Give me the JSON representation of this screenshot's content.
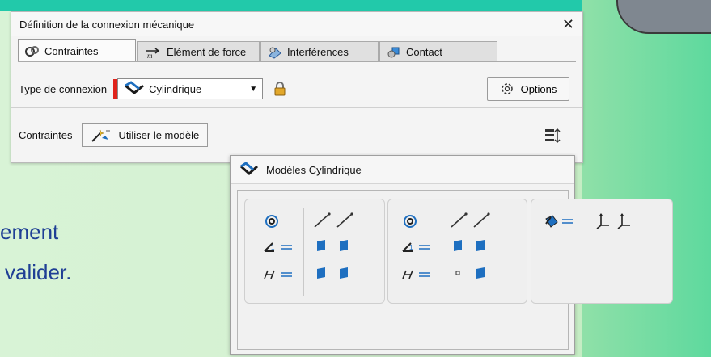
{
  "background": {
    "text_line1": "ement",
    "text_line2": "valider."
  },
  "dialog": {
    "title": "Définition de la connexion mécanique",
    "close_glyph": "✕",
    "tabs": [
      {
        "label": "Contraintes",
        "icon": "constraints-icon",
        "active": true
      },
      {
        "label": "Elément de force",
        "icon": "force-icon",
        "active": false
      },
      {
        "label": "Interférences",
        "icon": "interference-icon",
        "active": false
      },
      {
        "label": "Contact",
        "icon": "contact-icon",
        "active": false
      }
    ],
    "connection_type_label": "Type de connexion",
    "connection_type_value": "Cylindrique",
    "options_label": "Options",
    "constraints_label": "Contraintes",
    "use_model_label": "Utiliser le modèle"
  },
  "models_panel": {
    "title": "Modèles Cylindrique"
  },
  "colors": {
    "accent_red": "#e0241c",
    "icon_blue": "#1e6fc0",
    "bg_text": "#1f3f95"
  }
}
